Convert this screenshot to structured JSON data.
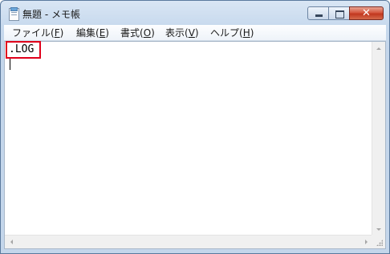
{
  "window": {
    "title": "無題 - メモ帳",
    "controls": {
      "minimize": "minimize-icon",
      "maximize": "maximize-icon",
      "close": "close-icon"
    }
  },
  "menubar": {
    "items": [
      {
        "label": "ファイル(",
        "key": "F",
        "end": ")"
      },
      {
        "label": "編集(",
        "key": "E",
        "end": ")"
      },
      {
        "label": "書式(",
        "key": "O",
        "end": ")"
      },
      {
        "label": "表示(",
        "key": "V",
        "end": ")"
      },
      {
        "label": "ヘルプ(",
        "key": "H",
        "end": ")"
      }
    ]
  },
  "editor": {
    "content": ".LOG",
    "highlight_color": "#e0001b"
  }
}
